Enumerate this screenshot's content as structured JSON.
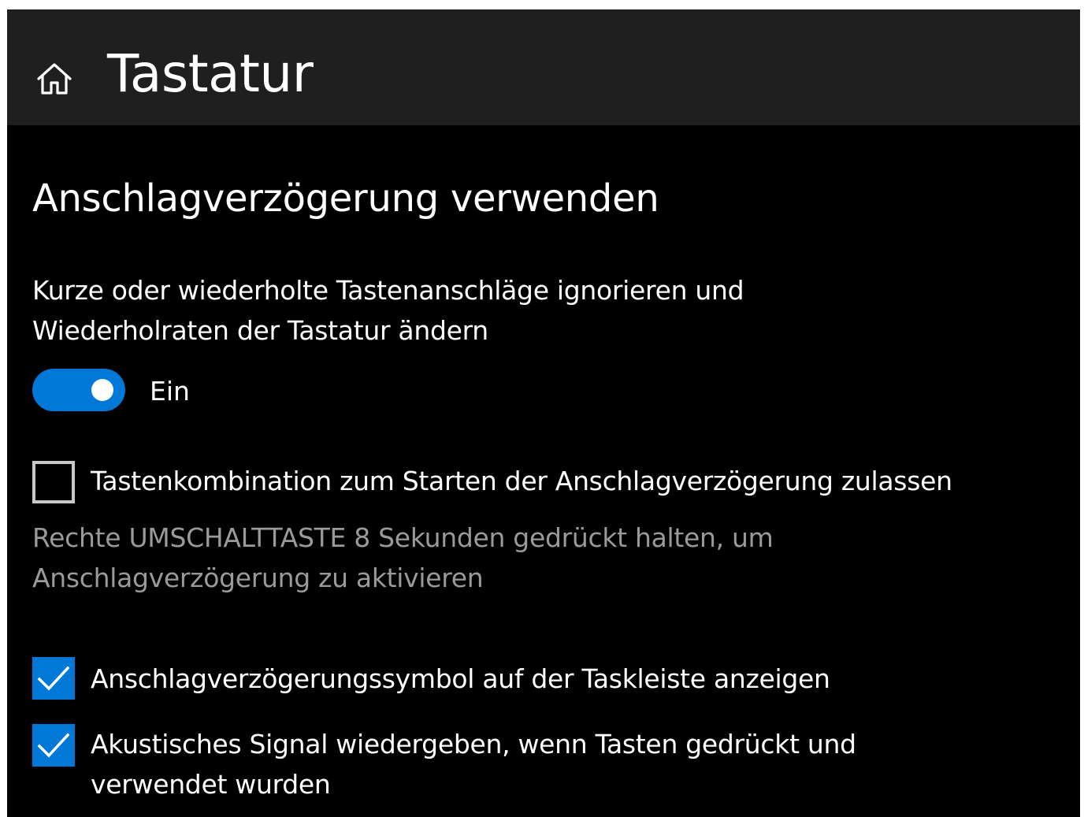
{
  "header": {
    "home_icon": "home-icon",
    "title": "Tastatur"
  },
  "section": {
    "title": "Anschlagverzögerung verwenden",
    "description": "Kurze oder wiederholte Tastenanschläge ignorieren und Wiederholraten der Tastatur ändern"
  },
  "toggle": {
    "state": "on",
    "label": "Ein",
    "color": "#0078d7"
  },
  "options": [
    {
      "label": "Tastenkombination zum Starten der Anschlagverzögerung zulassen",
      "checked": false,
      "hint": "Rechte UMSCHALTTASTE 8 Sekunden gedrückt halten, um Anschlagverzögerung zu aktivieren"
    },
    {
      "label": "Anschlagverzögerungssymbol auf der Taskleiste anzeigen",
      "checked": true
    },
    {
      "label": "Akustisches Signal wiedergeben, wenn Tasten gedrückt und verwendet wurden",
      "checked": true
    }
  ],
  "colors": {
    "accent": "#0078d7",
    "background": "#000000",
    "titlebar": "#1f1f1f",
    "hint_text": "#9a9a9a"
  }
}
